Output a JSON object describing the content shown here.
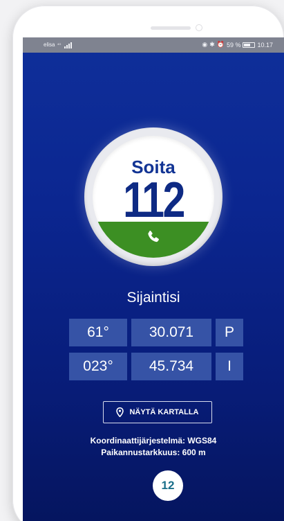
{
  "status_bar": {
    "carrier": "elisa",
    "battery": "59 %",
    "time": "10.17",
    "colors": {
      "bar": "#7f8390",
      "text": "#f1f2f6"
    }
  },
  "call_button": {
    "label": "Soita",
    "number": "112",
    "icon": "phone-icon",
    "colors": {
      "green": "#3c8f23",
      "blue": "#0e2a84"
    }
  },
  "location": {
    "title": "Sijaintisi",
    "latitude": {
      "degrees": "61°",
      "minutes": "30.071",
      "hemisphere": "P"
    },
    "longitude": {
      "degrees": "023°",
      "minutes": "45.734",
      "hemisphere": "I"
    }
  },
  "map_button": {
    "label": "NÄYTÄ KARTALLA",
    "icon": "map-pin-icon"
  },
  "info": {
    "coordinate_system": "Koordinaattijärjestelmä: WGS84",
    "accuracy": "Paikannustarkkuus: 600 m"
  },
  "badge": {
    "number": "12"
  },
  "theme": {
    "background_top": "#0f2f9a",
    "background_bottom": "#05155f",
    "cell": "#3653a6"
  }
}
